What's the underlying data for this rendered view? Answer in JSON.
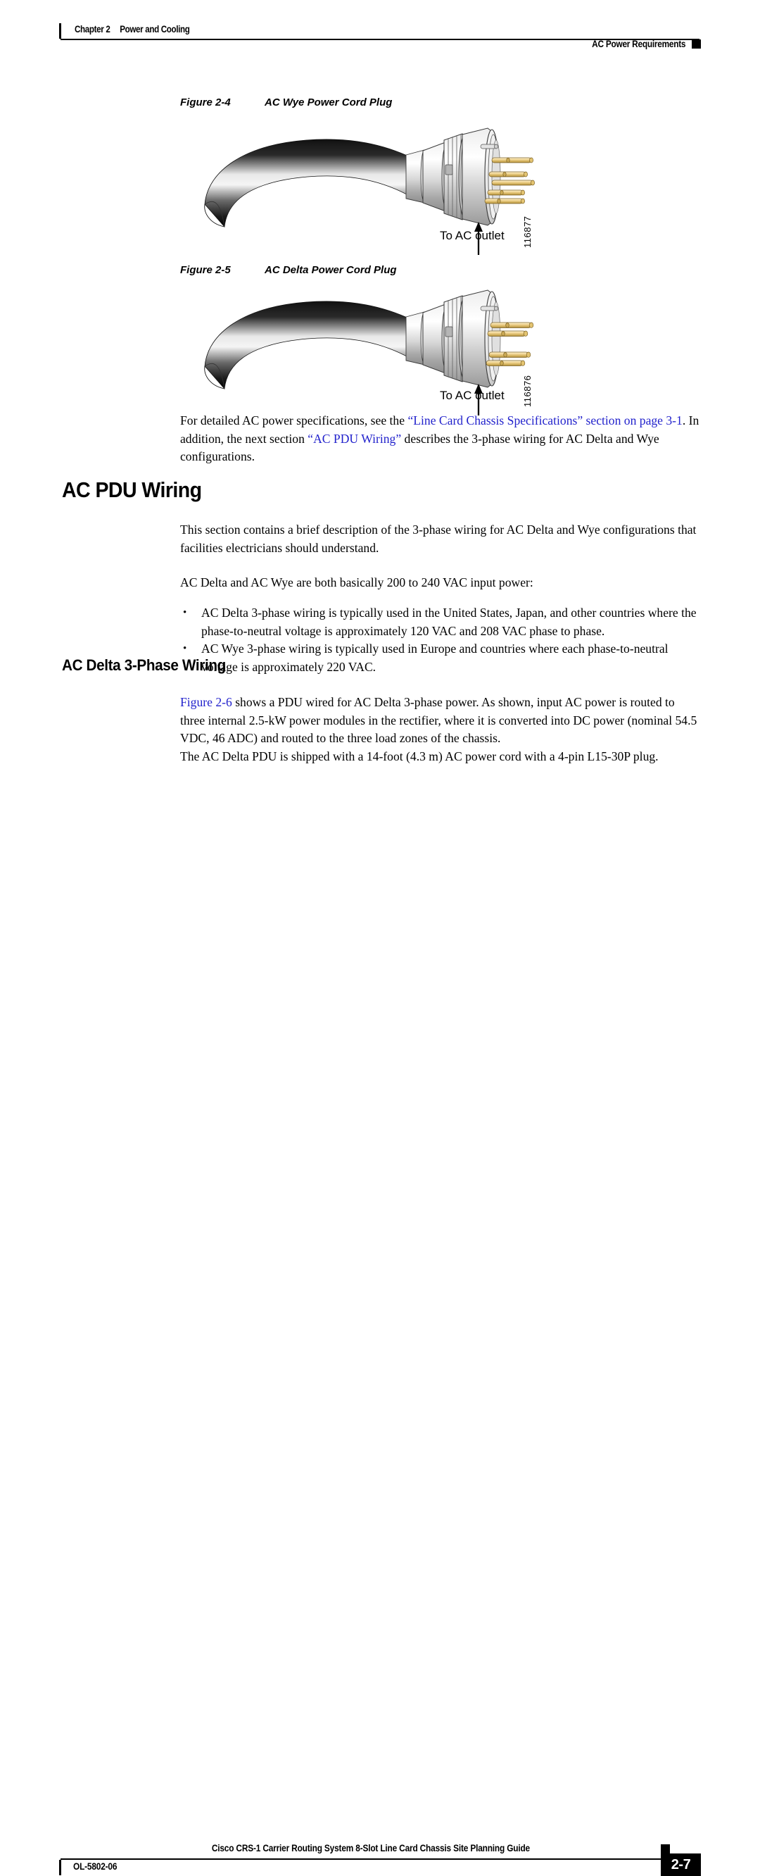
{
  "header": {
    "chapter_number": "Chapter 2",
    "chapter_title": "Power and Cooling",
    "section_title": "AC Power Requirements"
  },
  "figures": [
    {
      "number": "Figure 2-4",
      "title": "AC Wye Power Cord Plug",
      "arrow_label": "To AC outlet",
      "image_id": "116877",
      "pin_count": 5
    },
    {
      "number": "Figure 2-5",
      "title": "AC Delta Power Cord Plug",
      "arrow_label": "To AC outlet",
      "image_id": "116876",
      "pin_count": 4
    }
  ],
  "intro_paragraph": {
    "part1": "For detailed AC power specifications, see the ",
    "link1": "“Line Card Chassis Specifications” section on page 3-1",
    "part2": ". In addition, the next section ",
    "link2": "“AC PDU Wiring”",
    "part3": " describes the 3-phase wiring for AC Delta and Wye configurations."
  },
  "section_heading": "AC PDU Wiring",
  "section_paragraphs": [
    "This section contains a brief description of the 3-phase wiring for AC Delta and Wye configurations that facilities electricians should understand.",
    "AC Delta and AC Wye are both basically 200 to 240 VAC input power:"
  ],
  "bullets": [
    "AC Delta 3-phase wiring is typically used in the United States, Japan, and other countries where the phase-to-neutral voltage is approximately 120 VAC and 208 VAC phase to phase.",
    "AC Wye 3-phase wiring is typically used in Europe and countries where each phase-to-neutral voltage is approximately 220 VAC."
  ],
  "subsection_heading": "AC Delta 3-Phase Wiring",
  "delta_paragraph": {
    "link": "Figure 2-6",
    "rest": " shows a PDU wired for AC Delta 3-phase power. As shown, input AC power is routed to three internal 2.5-kW power modules in the rectifier, where it is converted into DC power (nominal 54.5 VDC, 46 ADC) and routed to the three load zones of the chassis."
  },
  "delta_paragraph2": "The AC Delta PDU is shipped with a 14-foot (4.3 m) AC power cord with a 4-pin L15-30P plug.",
  "footer": {
    "doc_id": "OL-5802-06",
    "guide_title": "Cisco CRS-1 Carrier Routing System 8-Slot Line Card Chassis Site Planning Guide",
    "page_number": "2-7"
  },
  "colors": {
    "link": "#2222cc",
    "text": "#000000",
    "accent": "#000000"
  }
}
